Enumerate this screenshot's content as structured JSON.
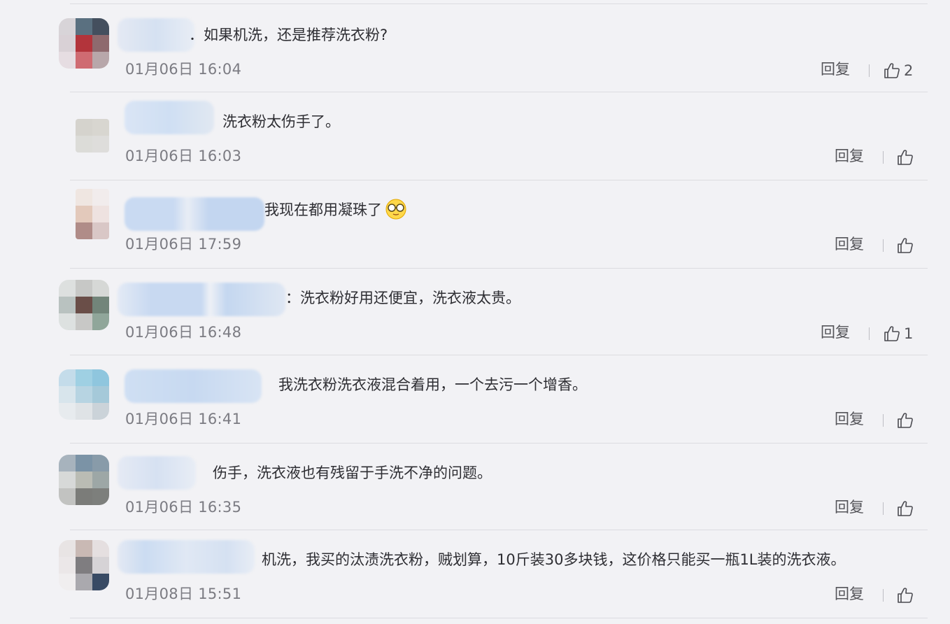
{
  "comments": [
    {
      "text": "．如果机洗，还是推荐洗衣粉?",
      "time": "01月06日 16:04",
      "reply": "回复",
      "likes": "2"
    },
    {
      "text": "洗衣粉太伤手了。",
      "time": "01月06日 16:03",
      "reply": "回复",
      "likes": ""
    },
    {
      "text": "我现在都用凝珠了",
      "time": "01月06日 17:59",
      "reply": "回复",
      "likes": ""
    },
    {
      "text": "：洗衣粉好用还便宜，洗衣液太贵。",
      "time": "01月06日 16:48",
      "reply": "回复",
      "likes": "1"
    },
    {
      "text": "我洗衣粉洗衣液混合着用，一个去污一个增香。",
      "time": "01月06日 16:41",
      "reply": "回复",
      "likes": ""
    },
    {
      "text": "伤手，洗衣液也有残留于手洗不净的问题。",
      "time": "01月06日 16:35",
      "reply": "回复",
      "likes": ""
    },
    {
      "text": "机洗，我买的汰渍洗衣粉，贼划算，10斤装30多块钱，这价格只能买一瓶1L装的洗衣液。",
      "time": "01月08日 15:51",
      "reply": "回复",
      "likes": ""
    }
  ],
  "icons": {
    "like": "thumbs-up-icon",
    "emoji": "glasses-emoji-icon"
  }
}
